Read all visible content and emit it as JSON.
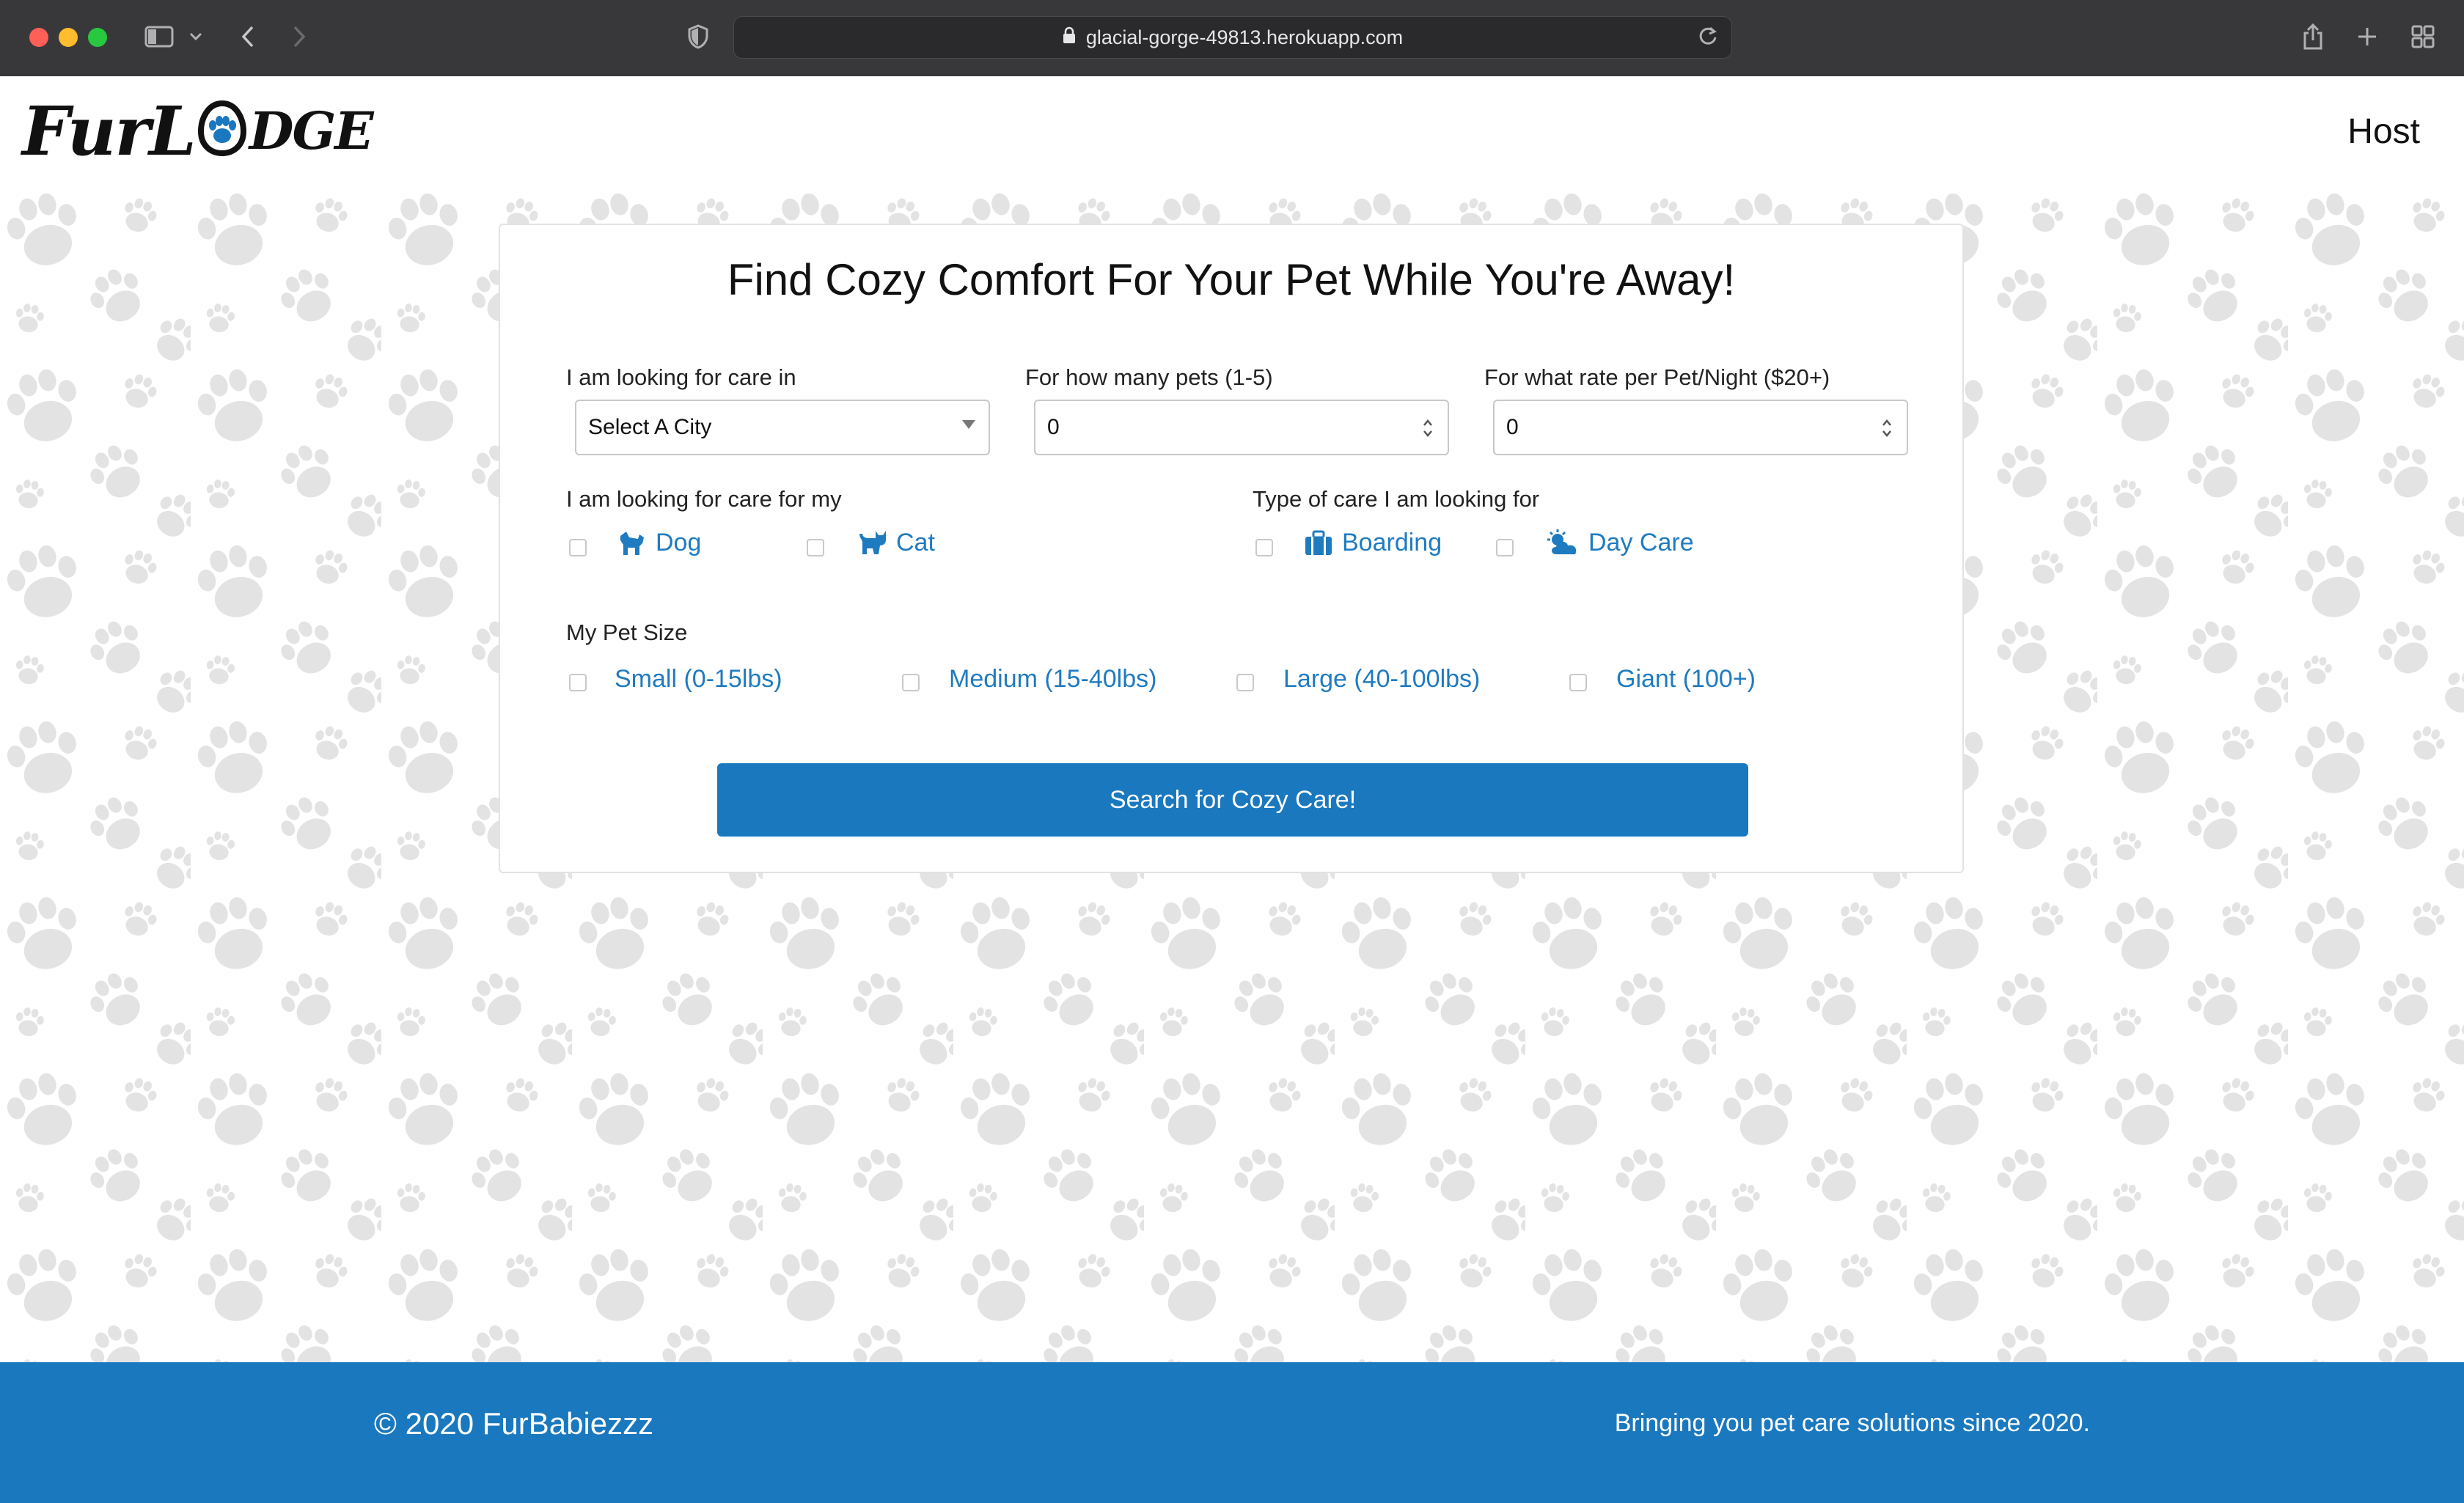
{
  "browser": {
    "url": "glacial-gorge-49813.herokuapp.com"
  },
  "header": {
    "logo_text_left": "FurL",
    "logo_text_right": "dge",
    "host_link": "Host"
  },
  "search": {
    "title": "Find Cozy Comfort For Your Pet While You're Away!",
    "city_label": "I am looking for care in",
    "city_value": "Select A City",
    "pets_label": "For how many pets (1-5)",
    "pets_value": "0",
    "rate_label": "For what rate per Pet/Night ($20+)",
    "rate_value": "0",
    "pet_type_label": "I am looking for care for my",
    "pet_types": [
      {
        "label": "Dog",
        "icon": "dog-icon",
        "checked": false
      },
      {
        "label": "Cat",
        "icon": "cat-icon",
        "checked": false
      }
    ],
    "care_type_label": "Type of care I am looking for",
    "care_types": [
      {
        "label": "Boarding",
        "icon": "suitcase-icon",
        "checked": false
      },
      {
        "label": "Day Care",
        "icon": "sun-cloud-icon",
        "checked": false
      }
    ],
    "size_label": "My Pet Size",
    "sizes": [
      {
        "label": "Small (0-15lbs)",
        "checked": false
      },
      {
        "label": "Medium (15-40lbs)",
        "checked": false
      },
      {
        "label": "Large (40-100lbs)",
        "checked": false
      },
      {
        "label": "Giant (100+)",
        "checked": false
      }
    ],
    "button_label": "Search for Cozy Care!"
  },
  "footer": {
    "copyright": "© 2020 FurBabiezzz",
    "tagline": "Bringing you pet care solutions since 2020."
  },
  "colors": {
    "brand_blue": "#1a78bf",
    "paw_gray": "#e6e6e6"
  }
}
